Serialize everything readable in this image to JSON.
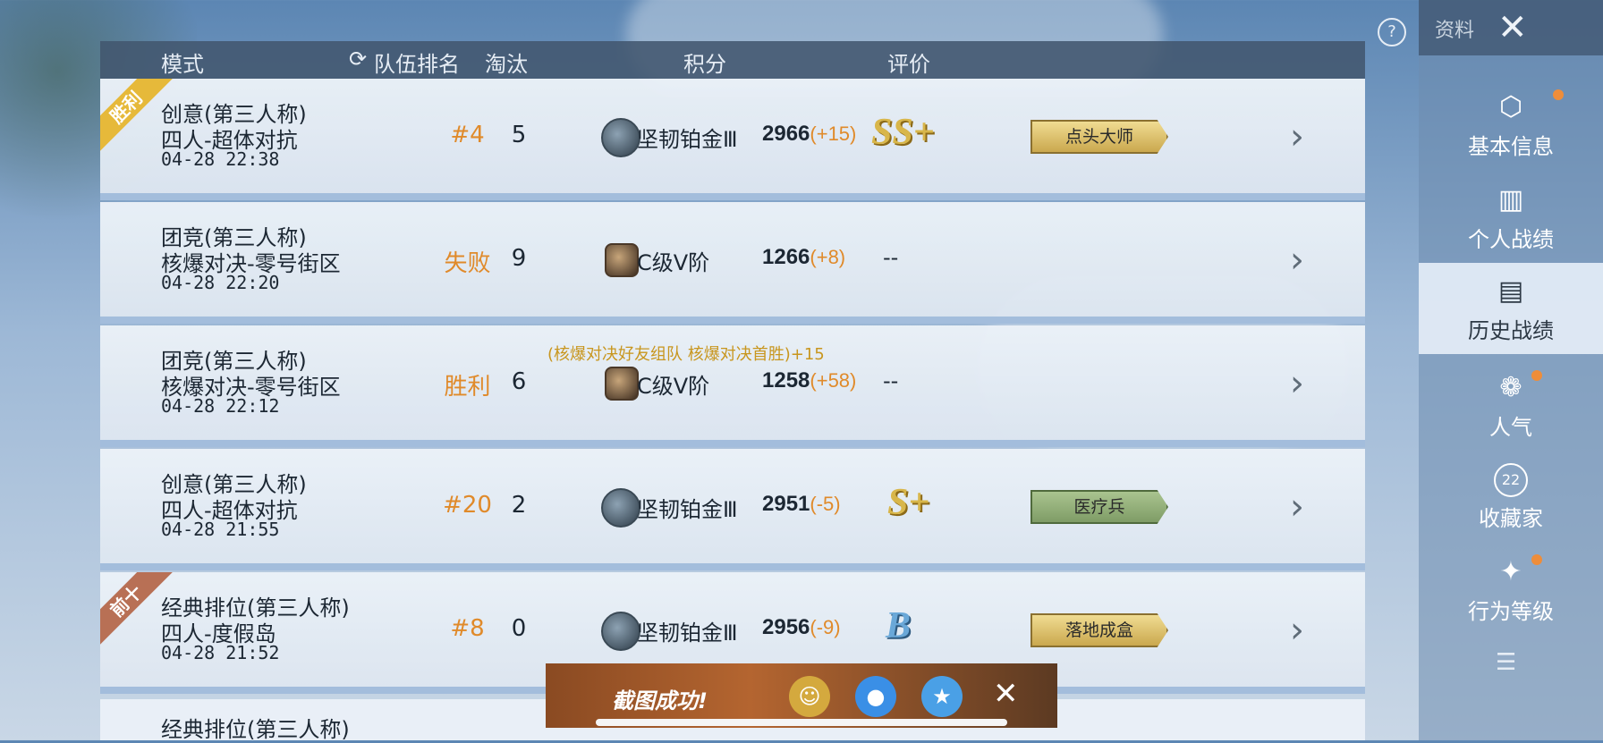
{
  "header": {
    "mode": "模式",
    "team_rank": "队伍排名",
    "elims": "淘汰",
    "points": "积分",
    "rating": "评价"
  },
  "rows": [
    {
      "ribbon": "胜利",
      "mode": "创意(第三人称)",
      "submode": "四人-超体对抗",
      "time": "04-28 22:38",
      "rank": "#4",
      "elims": "5",
      "tier": "坚韧铂金Ⅲ",
      "score": "2966",
      "delta": "(+15)",
      "grade": "SS+",
      "title": "点头大师"
    },
    {
      "ribbon": "",
      "mode": "团竞(第三人称)",
      "submode": "核爆对决-零号街区",
      "time": "04-28 22:20",
      "rank": "失败",
      "elims": "9",
      "tier": "C级Ⅴ阶",
      "score": "1266",
      "delta": "(+8)",
      "grade": "--",
      "title": ""
    },
    {
      "ribbon": "",
      "mode": "团竞(第三人称)",
      "submode": "核爆对决-零号街区",
      "time": "04-28 22:12",
      "rank": "胜利",
      "elims": "6",
      "tier": "C级Ⅴ阶",
      "score": "1258",
      "delta": "(+58)",
      "grade": "--",
      "title": "",
      "bonus": "(核爆对决好友组队 核爆对决首胜)+15"
    },
    {
      "ribbon": "",
      "mode": "创意(第三人称)",
      "submode": "四人-超体对抗",
      "time": "04-28 21:55",
      "rank": "#20",
      "elims": "2",
      "tier": "坚韧铂金Ⅲ",
      "score": "2951",
      "delta": "(-5)",
      "grade": "S+",
      "title": "医疗兵"
    },
    {
      "ribbon": "前十",
      "mode": "经典排位(第三人称)",
      "submode": "四人-度假岛",
      "time": "04-28 21:52",
      "rank": "#8",
      "elims": "0",
      "tier": "坚韧铂金Ⅲ",
      "score": "2956",
      "delta": "(-9)",
      "grade": "B",
      "title": "落地成盒"
    }
  ],
  "partial_row": {
    "mode": "经典排位(第三人称)"
  },
  "sidebar": {
    "top_label": "资料",
    "help": "?",
    "items": [
      {
        "label": "基本信息",
        "icon": "profile-icon"
      },
      {
        "label": "个人战绩",
        "icon": "stats-icon"
      },
      {
        "label": "历史战绩",
        "icon": "history-icon"
      },
      {
        "label": "人气",
        "icon": "popularity-icon"
      },
      {
        "label": "收藏家",
        "icon": "collector-icon",
        "badge": "22"
      },
      {
        "label": "行为等级",
        "icon": "behavior-icon"
      }
    ]
  },
  "toast": {
    "text": "截图成功!"
  },
  "colors": {
    "accent": "#e08a2a",
    "header_bg": "#42566e",
    "active_tab": "#e1ebf5"
  }
}
